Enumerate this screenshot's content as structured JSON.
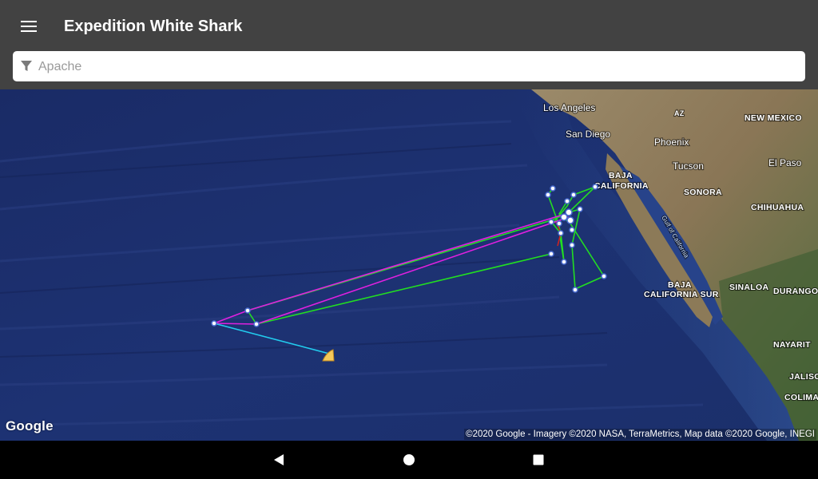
{
  "toolbar": {
    "menu_icon": "hamburger-menu-icon",
    "title": "Expedition White Shark",
    "background": "#424242"
  },
  "search": {
    "icon": "filter-icon",
    "placeholder": "Apache",
    "value": ""
  },
  "map": {
    "type": "satellite",
    "labels": {
      "los_angeles": "Los Angeles",
      "az": "AZ",
      "new_mexico": "NEW MEXICO",
      "san_diego": "San Diego",
      "phoenix": "Phoenix",
      "tucson": "Tucson",
      "el_paso": "El Paso",
      "baja_california_1": "BAJA",
      "baja_california_2": "CALIFORNIA",
      "sonora": "SONORA",
      "chihuahua": "CHIHUAHUA",
      "gulf_of_california": "Gulf of California",
      "baja_california_sur_1": "BAJA",
      "baja_california_sur_2": "CALIFORNIA SUR",
      "sinaloa": "SINALOA",
      "durango": "DURANGO",
      "nayarit": "NAYARIT",
      "jalisco": "JALISC",
      "colima": "COLIMA"
    },
    "google_logo": "Google",
    "attribution": "©2020 Google - Imagery ©2020 NASA, TerraMetrics, Map data ©2020 Google, INEGI",
    "track_colors": {
      "green": "#22dd22",
      "magenta": "#e020e0",
      "cyan": "#22ccee",
      "red": "#cc2222"
    },
    "marker_icon": "shark-fin-marker-icon"
  },
  "navbar": {
    "back_icon": "back-triangle-icon",
    "home_icon": "home-circle-icon",
    "recents_icon": "recents-square-icon"
  }
}
